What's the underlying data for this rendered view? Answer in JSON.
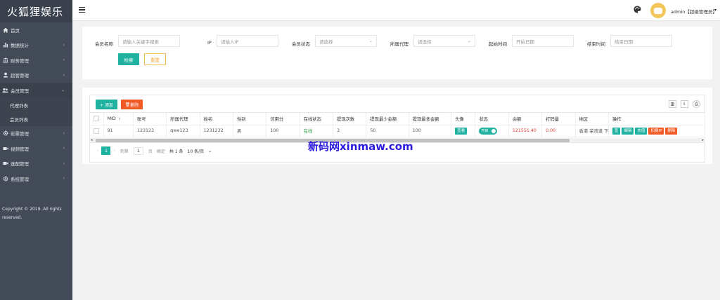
{
  "app": {
    "logo": "火狐狸娱乐"
  },
  "sidebar": {
    "items": [
      {
        "label": "首页",
        "icon": "home-icon",
        "arrow": ""
      },
      {
        "label": "数据统计",
        "icon": "bar-chart-icon",
        "arrow": "›"
      },
      {
        "label": "财务管理",
        "icon": "bank-icon",
        "arrow": "›"
      },
      {
        "label": "超管管理",
        "icon": "user-icon",
        "arrow": "›"
      },
      {
        "label": "会员管理",
        "icon": "users-icon",
        "arrow": "⌄"
      }
    ],
    "sub_items": [
      {
        "label": "代理列表"
      },
      {
        "label": "会员列表"
      }
    ],
    "items_after": [
      {
        "label": "彩票管理",
        "icon": "gear-icon",
        "arrow": "›"
      },
      {
        "label": "视频管理",
        "icon": "video-icon",
        "arrow": "›"
      },
      {
        "label": "选配管理",
        "icon": "video-icon",
        "arrow": "›"
      },
      {
        "label": "系统管理",
        "icon": "gear-icon",
        "arrow": "›"
      }
    ],
    "copyright": "Copyright © 2019. All rights reserved."
  },
  "header": {
    "user_label": "admin【超级管理员】",
    "caret": "▾"
  },
  "search": {
    "fields": [
      {
        "label": "会员名称",
        "placeholder": "请输入关键字搜索"
      },
      {
        "label": "IP",
        "placeholder": "请输入IP"
      },
      {
        "label": "会员状态",
        "placeholder": "请选择"
      },
      {
        "label": "所属代理",
        "placeholder": "请选择"
      },
      {
        "label": "起始时间",
        "placeholder": "开始日期"
      },
      {
        "label": "结束时间",
        "placeholder": "结束日期"
      }
    ],
    "search_button": "检索",
    "reset_button": "重置"
  },
  "toolbar": {
    "add_button": "+ 添加",
    "delete_button": "删除"
  },
  "table": {
    "columns": [
      "MID",
      "账号",
      "所属代理",
      "姓名",
      "性别",
      "信用分",
      "在线状态",
      "提现次数",
      "提现最少金额",
      "提现最多金额",
      "头像",
      "状态",
      "余额",
      "打码量",
      "地区",
      "操作"
    ],
    "rows": [
      {
        "mid": "91",
        "account": "123123",
        "agent": "qwe123",
        "name": "1231232",
        "gender": "男",
        "credit": "100",
        "online": "在线",
        "withdraw_count": "3",
        "withdraw_min": "50",
        "withdraw_max": "100",
        "avatar_btn": "查看",
        "status_switch": "开启",
        "balance": "121551.40",
        "code_amount": "0.00",
        "region": "香港 荣湾道 下",
        "actions": [
          "查",
          "编辑",
          "充值",
          "扣费IP",
          "删除"
        ]
      }
    ]
  },
  "pager": {
    "current": "1",
    "goto_label": "到第",
    "page_input": "1",
    "page_unit": "页",
    "confirm": "确定",
    "total": "共 1 条",
    "page_size": "10 条/页"
  },
  "watermark": "新码网xinmaw.com"
}
